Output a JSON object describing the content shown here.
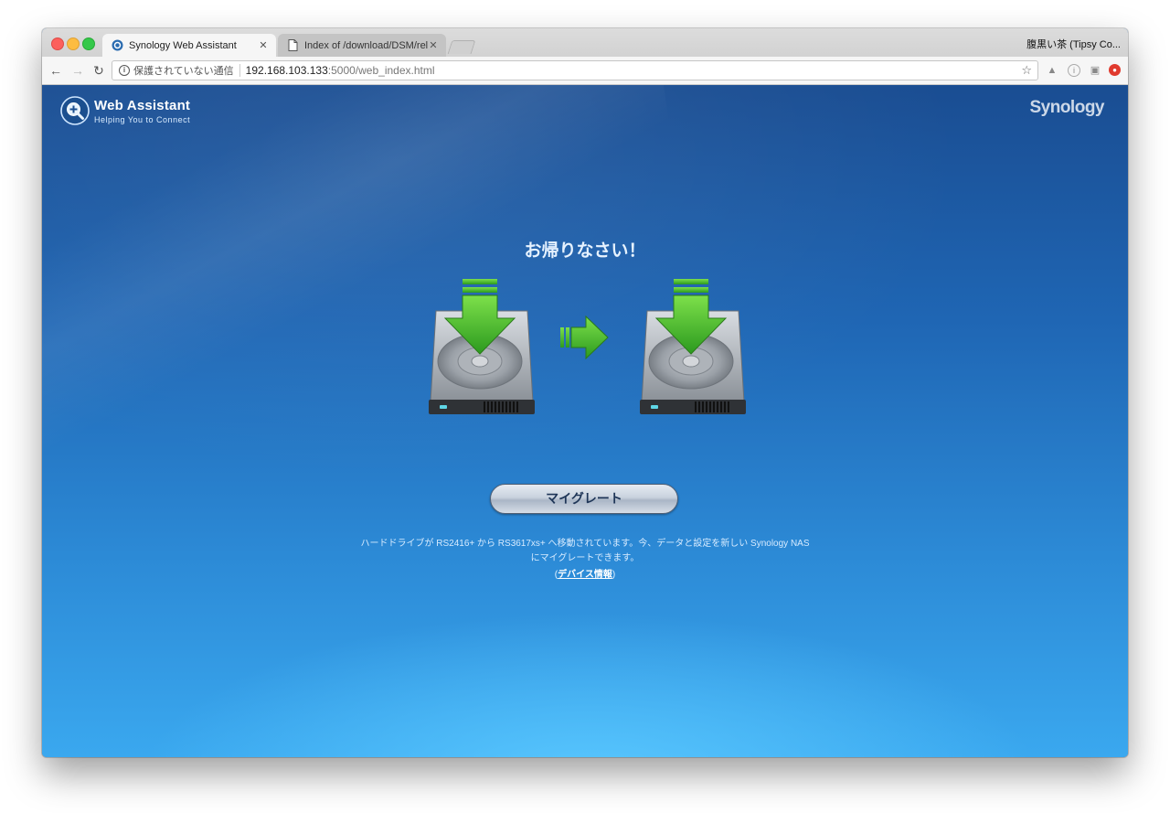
{
  "browser": {
    "tabs": [
      {
        "label": "Synology Web Assistant",
        "icon": "synology-icon",
        "active": true
      },
      {
        "label": "Index of /download/DSM/releas",
        "icon": "document-icon",
        "active": false
      }
    ],
    "profile_name": "腹黒い茶 (Tipsy Co...",
    "address": {
      "security_label": "保護されていない通信",
      "host": "192.168.103.133",
      "path": ":5000/web_index.html"
    }
  },
  "app": {
    "title": "Web Assistant",
    "subtitle": "Helping You to Connect",
    "brand": "Synology"
  },
  "main": {
    "heading": "お帰りなさい！",
    "migrate_button": "マイグレート",
    "description": "ハードドライブが RS2416+ から RS3617xs+ へ移動されています。今、データと設定を新しい Synology NAS にマイグレートできます。",
    "device_info_prefix": "(",
    "device_info_link": "デバイス情報",
    "device_info_suffix": ")"
  },
  "colors": {
    "accent_green": "#4bb830",
    "background_blue": "#1f66b4"
  }
}
